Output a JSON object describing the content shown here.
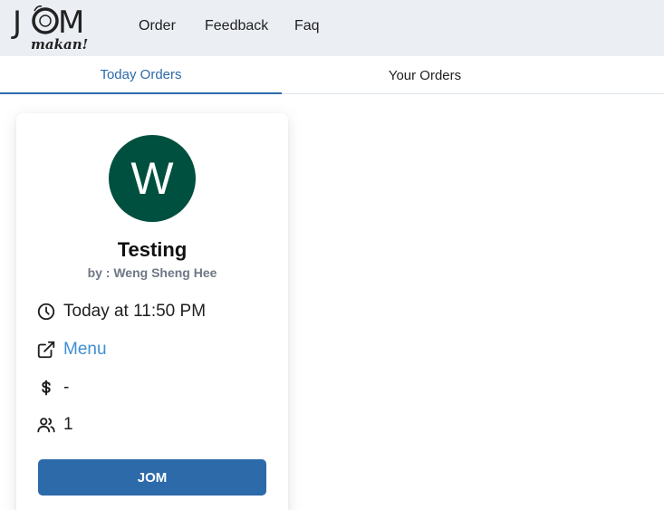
{
  "header": {
    "logo_text": "JOM",
    "logo_subtext": "makan!",
    "nav": [
      "Order",
      "Feedback",
      "Faq"
    ]
  },
  "tabs": [
    {
      "label": "Today Orders",
      "active": true
    },
    {
      "label": "Your Orders",
      "active": false
    }
  ],
  "order_card": {
    "avatar_letter": "W",
    "avatar_color": "#00503f",
    "title": "Testing",
    "byline": "by : Weng Sheng Hee",
    "time": "Today at 11:50 PM",
    "menu_link": "Menu",
    "price": "-",
    "people": "1",
    "join_button": "JOM"
  },
  "colors": {
    "accent": "#2c6aaa",
    "link": "#3f8fd2",
    "header_bg": "#ebeff4"
  },
  "icons": [
    "clock-icon",
    "external-link-icon",
    "dollar-icon",
    "users-icon"
  ]
}
